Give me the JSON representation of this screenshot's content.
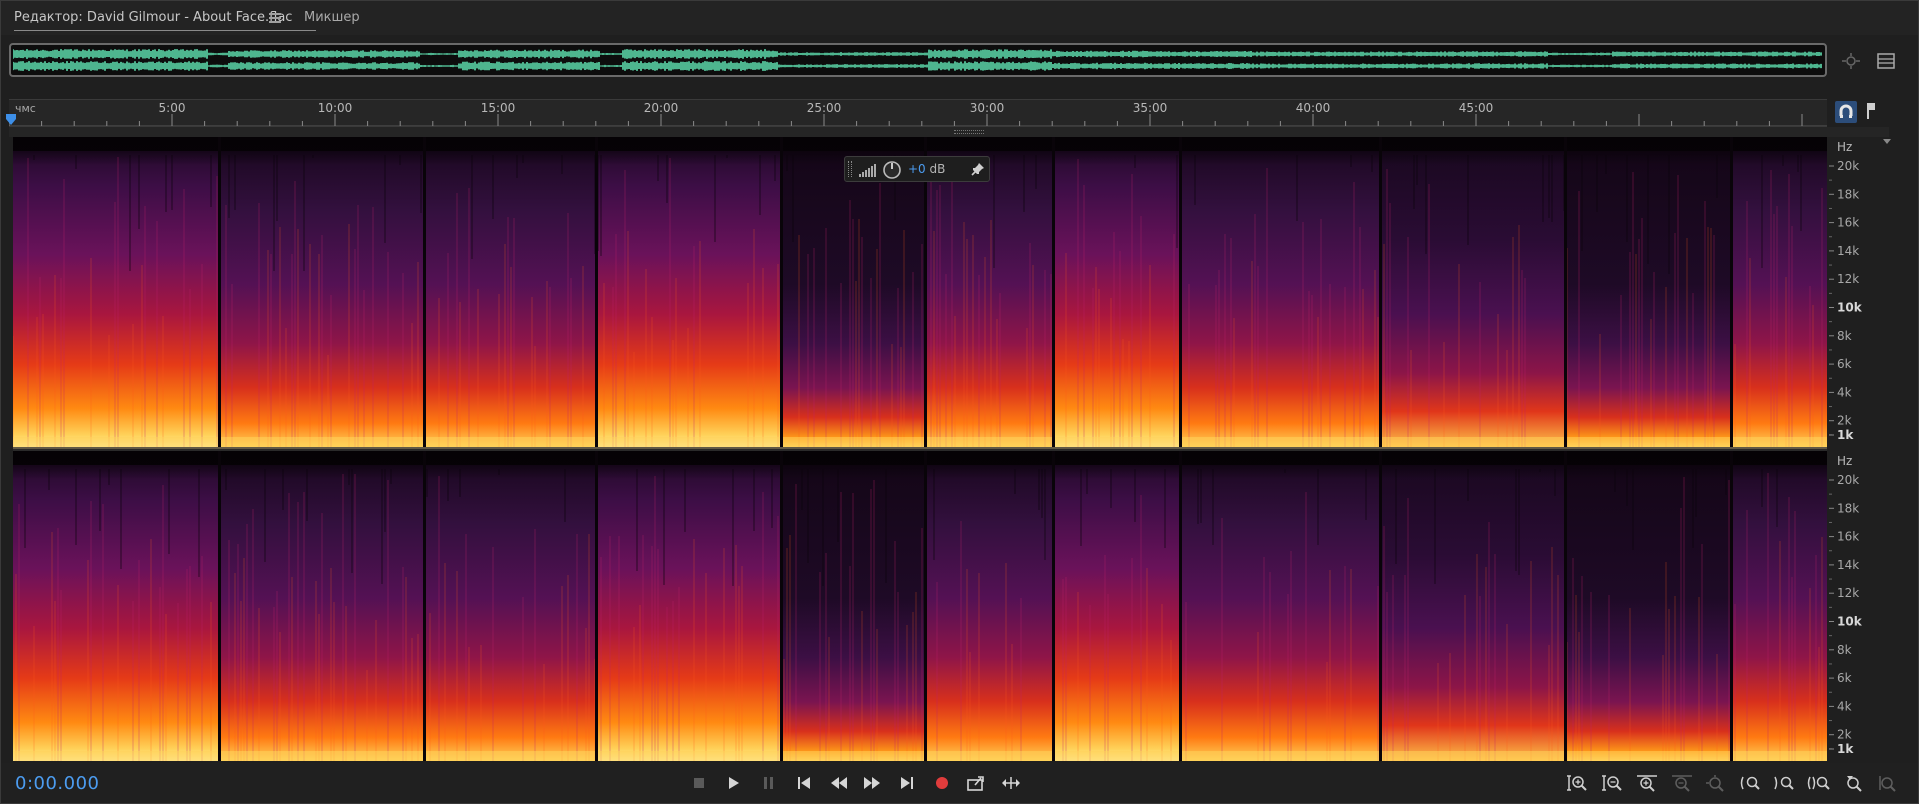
{
  "tabs": {
    "editor": "Редактор: David Gilmour - About Face.flac",
    "mixer": "Микшер"
  },
  "ruler": {
    "unit_label": "чмс",
    "labels": [
      "5:00",
      "10:00",
      "15:00",
      "20:00",
      "25:00",
      "30:00",
      "35:00",
      "40:00",
      "45:00"
    ]
  },
  "frequency_scale": {
    "unit": "Hz",
    "labels": [
      "20k",
      "18k",
      "16k",
      "14k",
      "12k",
      "10k",
      "8k",
      "6k",
      "4k",
      "2k",
      "1k"
    ]
  },
  "hud": {
    "volume": "+0",
    "unit": "dB"
  },
  "transport": {
    "time": "0:00.000",
    "buttons": [
      "stop",
      "play",
      "pause",
      "go-to-start",
      "rewind",
      "fast-forward",
      "go-to-end",
      "record",
      "skip-selection",
      "loop"
    ]
  },
  "zoom_tools": [
    "zoom-in-amplitude",
    "zoom-out-amplitude",
    "zoom-in-time",
    "zoom-out-time",
    "zoom-to-selection",
    "zoom-in-left",
    "zoom-in-right",
    "zoom-out-full",
    "zoom-to-playhead",
    "zoom-reset"
  ],
  "colors": {
    "accent": "#4c9cf0",
    "waveform": "#5fe0b0",
    "record": "#e03c3c",
    "panel": "#1f1f1f"
  }
}
